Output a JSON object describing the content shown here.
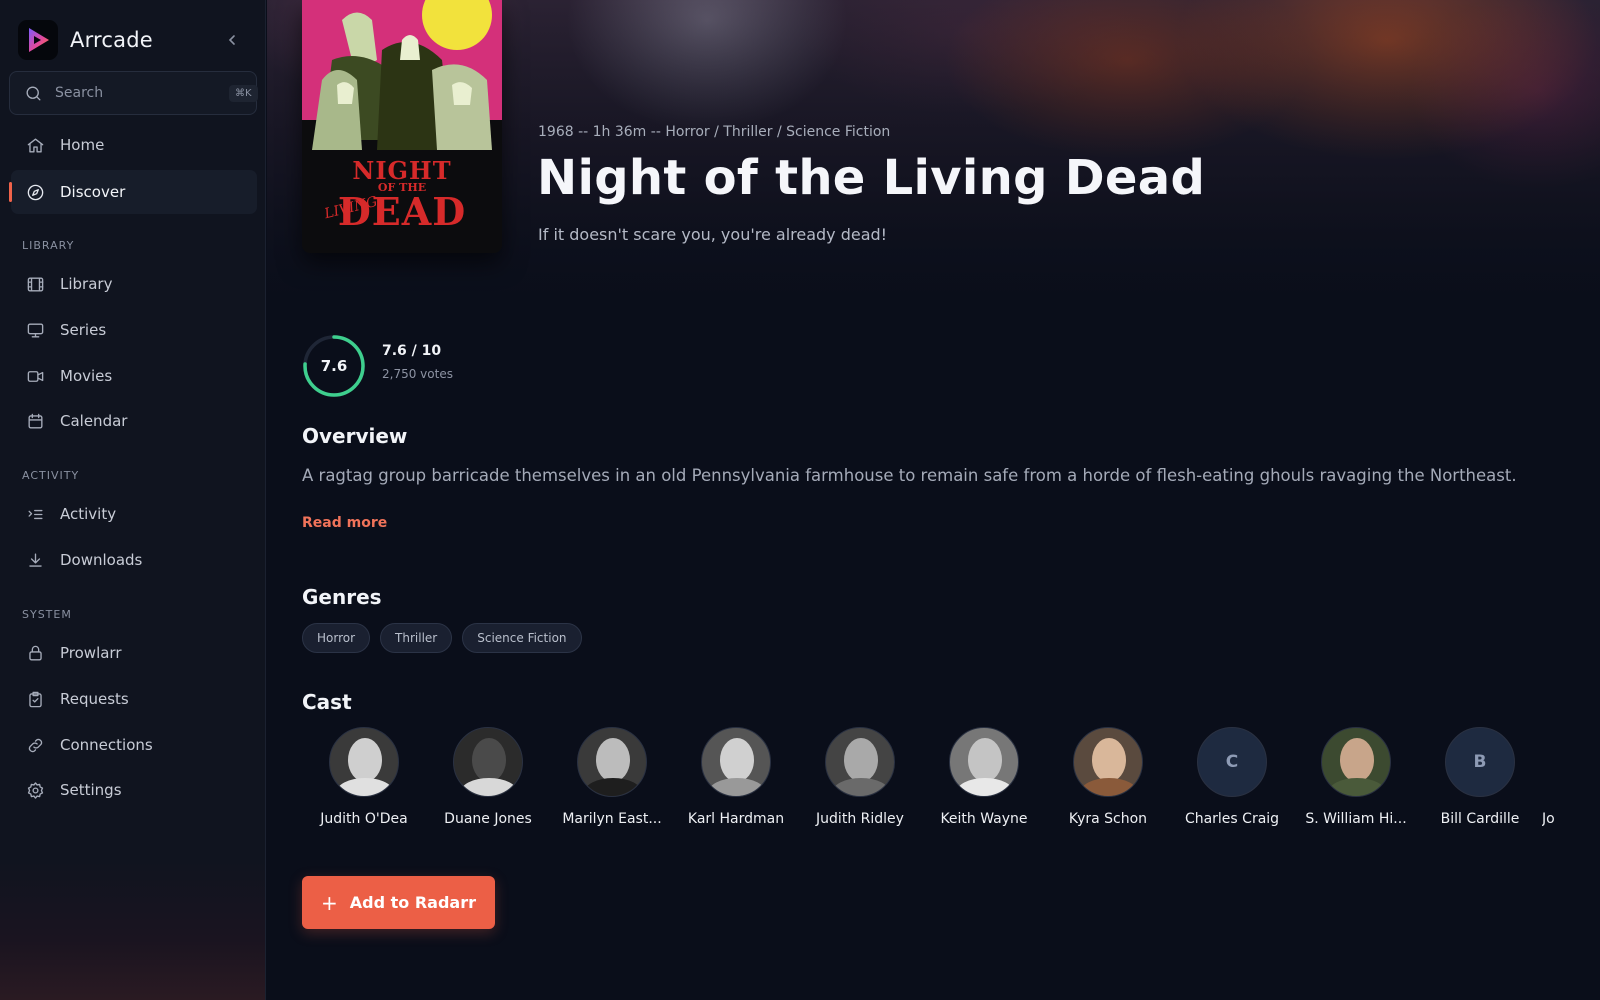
{
  "app": {
    "name": "Arrcade",
    "search_placeholder": "Search",
    "search_shortcut": "⌘K"
  },
  "sidebar": {
    "top_items": [
      {
        "label": "Home",
        "icon": "home-icon"
      },
      {
        "label": "Discover",
        "icon": "compass-icon",
        "active": true
      }
    ],
    "sections": [
      {
        "title": "LIBRARY",
        "items": [
          {
            "label": "Library",
            "icon": "film-icon"
          },
          {
            "label": "Series",
            "icon": "monitor-icon"
          },
          {
            "label": "Movies",
            "icon": "video-icon"
          },
          {
            "label": "Calendar",
            "icon": "calendar-icon"
          }
        ]
      },
      {
        "title": "ACTIVITY",
        "items": [
          {
            "label": "Activity",
            "icon": "activity-list-icon"
          },
          {
            "label": "Downloads",
            "icon": "download-icon"
          }
        ]
      },
      {
        "title": "SYSTEM",
        "items": [
          {
            "label": "Prowlarr",
            "icon": "lock-icon"
          },
          {
            "label": "Requests",
            "icon": "clipboard-icon"
          },
          {
            "label": "Connections",
            "icon": "link-icon"
          },
          {
            "label": "Settings",
            "icon": "gear-icon"
          }
        ]
      }
    ]
  },
  "movie": {
    "meta": "1968 -- 1h 36m -- Horror / Thriller / Science Fiction",
    "title": "Night of the Living Dead",
    "tagline": "If it doesn't scare you, you're already dead!",
    "poster": {
      "line1": "NIGHT",
      "line2": "OF THE",
      "line3": "DEAD",
      "living": "LIVING"
    },
    "rating": {
      "value": "7.6",
      "fraction": 0.76,
      "label": "7.6 / 10",
      "votes": "2,750 votes"
    },
    "overview_heading": "Overview",
    "overview": "A ragtag group barricade themselves in an old Pennsylvania farmhouse to remain safe from a horde of flesh-eating ghouls ravaging the Northeast.",
    "read_more": "Read more",
    "genres_heading": "Genres",
    "genres": [
      "Horror",
      "Thriller",
      "Science Fiction"
    ],
    "cast_heading": "Cast",
    "cast": [
      {
        "name": "Judith O'Dea"
      },
      {
        "name": "Duane Jones"
      },
      {
        "name": "Marilyn East..."
      },
      {
        "name": "Karl Hardman"
      },
      {
        "name": "Judith Ridley"
      },
      {
        "name": "Keith Wayne"
      },
      {
        "name": "Kyra Schon"
      },
      {
        "name": "Charles Craig",
        "initial": "C"
      },
      {
        "name": "S. William Hi..."
      },
      {
        "name": "Bill Cardille",
        "initial": "B"
      },
      {
        "name": "Jo"
      }
    ],
    "add_button": "Add to Radarr"
  },
  "colors": {
    "accent": "#ec5f46",
    "rating_ring": "#3ecf8e",
    "background": "#0a0e1a"
  }
}
